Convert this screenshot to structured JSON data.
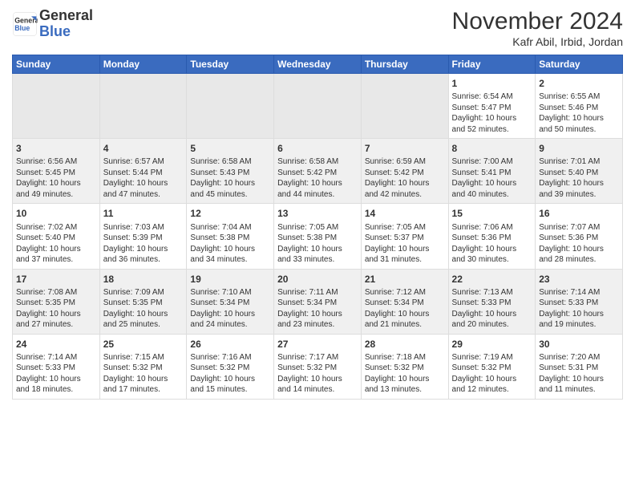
{
  "logo": {
    "line1": "General",
    "line2": "Blue"
  },
  "title": "November 2024",
  "location": "Kafr Abil, Irbid, Jordan",
  "weekdays": [
    "Sunday",
    "Monday",
    "Tuesday",
    "Wednesday",
    "Thursday",
    "Friday",
    "Saturday"
  ],
  "weeks": [
    [
      {
        "day": "",
        "empty": true
      },
      {
        "day": "",
        "empty": true
      },
      {
        "day": "",
        "empty": true
      },
      {
        "day": "",
        "empty": true
      },
      {
        "day": "",
        "empty": true
      },
      {
        "day": "1",
        "sunrise": "Sunrise: 6:54 AM",
        "sunset": "Sunset: 5:47 PM",
        "daylight": "Daylight: 10 hours and 52 minutes."
      },
      {
        "day": "2",
        "sunrise": "Sunrise: 6:55 AM",
        "sunset": "Sunset: 5:46 PM",
        "daylight": "Daylight: 10 hours and 50 minutes."
      }
    ],
    [
      {
        "day": "3",
        "sunrise": "Sunrise: 6:56 AM",
        "sunset": "Sunset: 5:45 PM",
        "daylight": "Daylight: 10 hours and 49 minutes."
      },
      {
        "day": "4",
        "sunrise": "Sunrise: 6:57 AM",
        "sunset": "Sunset: 5:44 PM",
        "daylight": "Daylight: 10 hours and 47 minutes."
      },
      {
        "day": "5",
        "sunrise": "Sunrise: 6:58 AM",
        "sunset": "Sunset: 5:43 PM",
        "daylight": "Daylight: 10 hours and 45 minutes."
      },
      {
        "day": "6",
        "sunrise": "Sunrise: 6:58 AM",
        "sunset": "Sunset: 5:42 PM",
        "daylight": "Daylight: 10 hours and 44 minutes."
      },
      {
        "day": "7",
        "sunrise": "Sunrise: 6:59 AM",
        "sunset": "Sunset: 5:42 PM",
        "daylight": "Daylight: 10 hours and 42 minutes."
      },
      {
        "day": "8",
        "sunrise": "Sunrise: 7:00 AM",
        "sunset": "Sunset: 5:41 PM",
        "daylight": "Daylight: 10 hours and 40 minutes."
      },
      {
        "day": "9",
        "sunrise": "Sunrise: 7:01 AM",
        "sunset": "Sunset: 5:40 PM",
        "daylight": "Daylight: 10 hours and 39 minutes."
      }
    ],
    [
      {
        "day": "10",
        "sunrise": "Sunrise: 7:02 AM",
        "sunset": "Sunset: 5:40 PM",
        "daylight": "Daylight: 10 hours and 37 minutes."
      },
      {
        "day": "11",
        "sunrise": "Sunrise: 7:03 AM",
        "sunset": "Sunset: 5:39 PM",
        "daylight": "Daylight: 10 hours and 36 minutes."
      },
      {
        "day": "12",
        "sunrise": "Sunrise: 7:04 AM",
        "sunset": "Sunset: 5:38 PM",
        "daylight": "Daylight: 10 hours and 34 minutes."
      },
      {
        "day": "13",
        "sunrise": "Sunrise: 7:05 AM",
        "sunset": "Sunset: 5:38 PM",
        "daylight": "Daylight: 10 hours and 33 minutes."
      },
      {
        "day": "14",
        "sunrise": "Sunrise: 7:05 AM",
        "sunset": "Sunset: 5:37 PM",
        "daylight": "Daylight: 10 hours and 31 minutes."
      },
      {
        "day": "15",
        "sunrise": "Sunrise: 7:06 AM",
        "sunset": "Sunset: 5:36 PM",
        "daylight": "Daylight: 10 hours and 30 minutes."
      },
      {
        "day": "16",
        "sunrise": "Sunrise: 7:07 AM",
        "sunset": "Sunset: 5:36 PM",
        "daylight": "Daylight: 10 hours and 28 minutes."
      }
    ],
    [
      {
        "day": "17",
        "sunrise": "Sunrise: 7:08 AM",
        "sunset": "Sunset: 5:35 PM",
        "daylight": "Daylight: 10 hours and 27 minutes."
      },
      {
        "day": "18",
        "sunrise": "Sunrise: 7:09 AM",
        "sunset": "Sunset: 5:35 PM",
        "daylight": "Daylight: 10 hours and 25 minutes."
      },
      {
        "day": "19",
        "sunrise": "Sunrise: 7:10 AM",
        "sunset": "Sunset: 5:34 PM",
        "daylight": "Daylight: 10 hours and 24 minutes."
      },
      {
        "day": "20",
        "sunrise": "Sunrise: 7:11 AM",
        "sunset": "Sunset: 5:34 PM",
        "daylight": "Daylight: 10 hours and 23 minutes."
      },
      {
        "day": "21",
        "sunrise": "Sunrise: 7:12 AM",
        "sunset": "Sunset: 5:34 PM",
        "daylight": "Daylight: 10 hours and 21 minutes."
      },
      {
        "day": "22",
        "sunrise": "Sunrise: 7:13 AM",
        "sunset": "Sunset: 5:33 PM",
        "daylight": "Daylight: 10 hours and 20 minutes."
      },
      {
        "day": "23",
        "sunrise": "Sunrise: 7:14 AM",
        "sunset": "Sunset: 5:33 PM",
        "daylight": "Daylight: 10 hours and 19 minutes."
      }
    ],
    [
      {
        "day": "24",
        "sunrise": "Sunrise: 7:14 AM",
        "sunset": "Sunset: 5:33 PM",
        "daylight": "Daylight: 10 hours and 18 minutes."
      },
      {
        "day": "25",
        "sunrise": "Sunrise: 7:15 AM",
        "sunset": "Sunset: 5:32 PM",
        "daylight": "Daylight: 10 hours and 17 minutes."
      },
      {
        "day": "26",
        "sunrise": "Sunrise: 7:16 AM",
        "sunset": "Sunset: 5:32 PM",
        "daylight": "Daylight: 10 hours and 15 minutes."
      },
      {
        "day": "27",
        "sunrise": "Sunrise: 7:17 AM",
        "sunset": "Sunset: 5:32 PM",
        "daylight": "Daylight: 10 hours and 14 minutes."
      },
      {
        "day": "28",
        "sunrise": "Sunrise: 7:18 AM",
        "sunset": "Sunset: 5:32 PM",
        "daylight": "Daylight: 10 hours and 13 minutes."
      },
      {
        "day": "29",
        "sunrise": "Sunrise: 7:19 AM",
        "sunset": "Sunset: 5:32 PM",
        "daylight": "Daylight: 10 hours and 12 minutes."
      },
      {
        "day": "30",
        "sunrise": "Sunrise: 7:20 AM",
        "sunset": "Sunset: 5:31 PM",
        "daylight": "Daylight: 10 hours and 11 minutes."
      }
    ]
  ]
}
